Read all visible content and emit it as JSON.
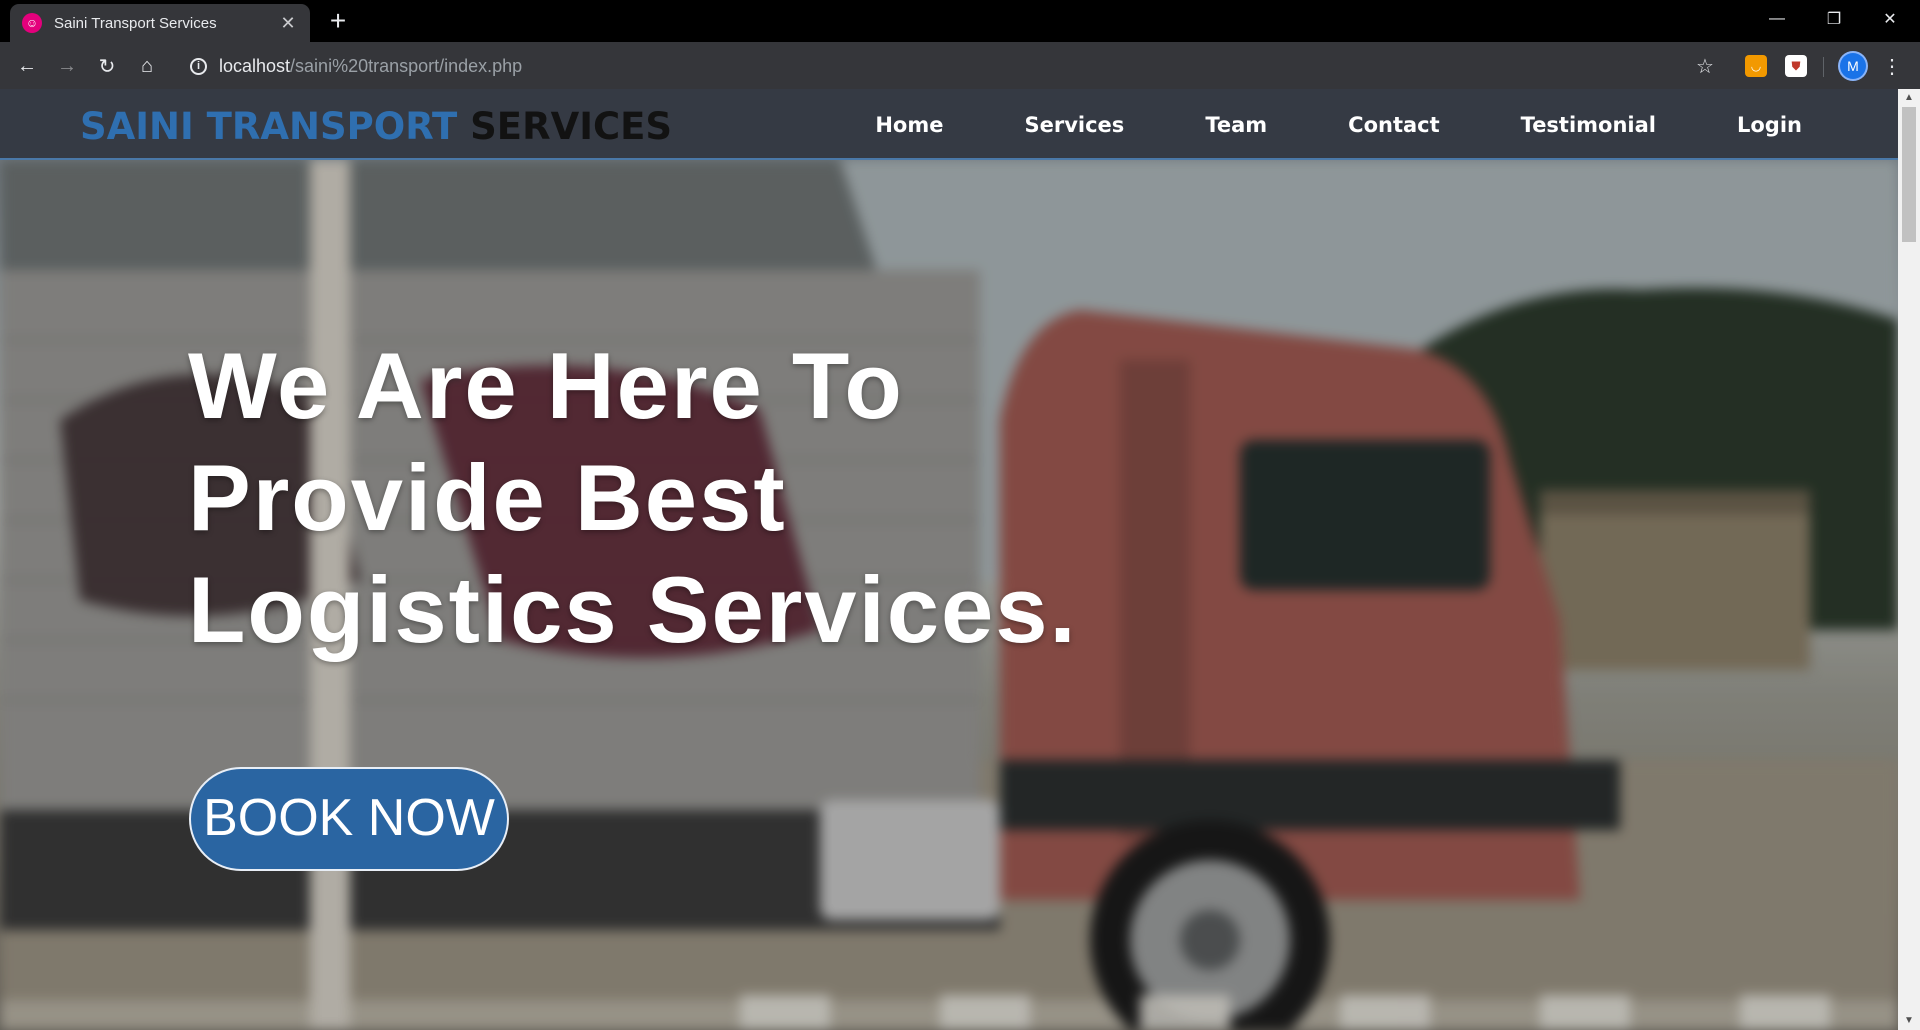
{
  "browser": {
    "tab": {
      "title": "Saini Transport Services",
      "close_glyph": "✕",
      "favicon": "favicon-icon"
    },
    "new_tab_glyph": "+",
    "window_controls": {
      "minimize": "—",
      "restore": "❐",
      "close": "✕"
    },
    "nav": {
      "back": "←",
      "forward": "→",
      "reload": "↻",
      "home": "⌂"
    },
    "address": {
      "host": "localhost",
      "path": "/saini%20transport/index.php",
      "info_glyph": "i"
    },
    "bookmark_glyph": "☆",
    "avatar_letter": "M",
    "menu_glyph": "⋮",
    "extensions": [
      {
        "name": "extension-orange-icon",
        "color": "#f29900"
      },
      {
        "name": "extension-pocket-icon",
        "color": "#ffffff"
      }
    ]
  },
  "site": {
    "brand": {
      "part1": "SAINI TRANSPORT",
      "part2": " SERVICES"
    },
    "nav": [
      "Home",
      "Services",
      "Team",
      "Contact",
      "Testimonial",
      "Login"
    ],
    "hero": {
      "headline_lines": [
        "We Are Here To",
        "Provide Best",
        "Logistics Services."
      ],
      "cta_label": "BOOK NOW"
    }
  },
  "scrollbar": {
    "up": "▲",
    "down": "▼"
  },
  "colors": {
    "brand_blue": "#2f6fb0",
    "cta_blue": "#2a65a2",
    "nav_bg": "#353a44"
  }
}
